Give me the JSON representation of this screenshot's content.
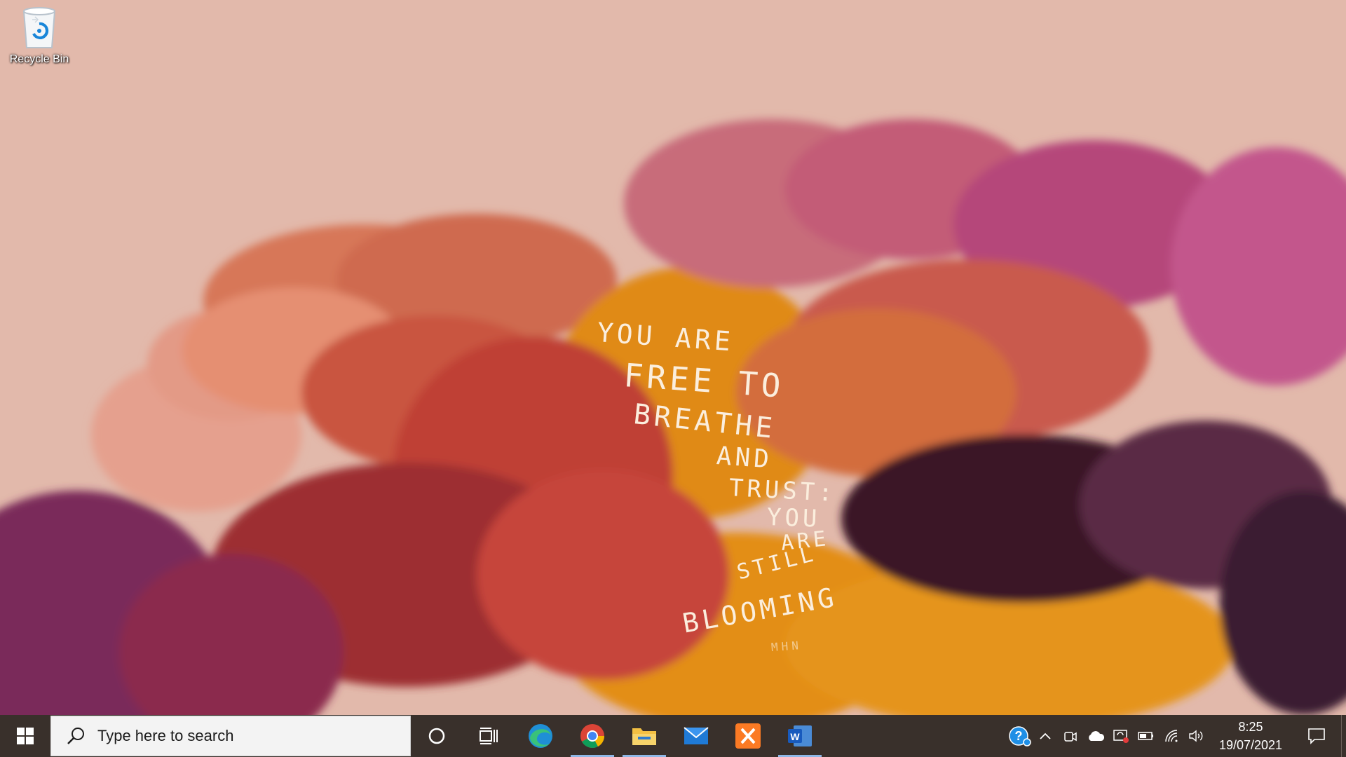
{
  "desktop": {
    "icons": [
      {
        "label": "Recycle Bin",
        "icon": "recycle-bin-icon"
      }
    ],
    "wallpaper": {
      "quote_lines": [
        "YOU ARE",
        "FREE TO",
        "BREATHE",
        "AND",
        "TRUST:",
        "YOU",
        "ARE",
        "STILL",
        "BLOOMING"
      ],
      "signature": "MHN",
      "colors": {
        "background": "#e2b9ab",
        "orange": "#e08a14",
        "red": "#b9473a",
        "plum": "#7a2a5a",
        "dark": "#3a1428",
        "pink": "#c76a8e"
      }
    }
  },
  "taskbar": {
    "start_icon": "windows-logo-icon",
    "search": {
      "placeholder": "Type here to search",
      "icon": "search-icon"
    },
    "cortana_icon": "cortana-circle-icon",
    "task_view_icon": "task-view-icon",
    "pinned_apps": [
      {
        "name": "Microsoft Edge",
        "icon": "edge-icon",
        "active": false
      },
      {
        "name": "Google Chrome",
        "icon": "chrome-icon",
        "active": true
      },
      {
        "name": "File Explorer",
        "icon": "file-explorer-icon",
        "active": true
      },
      {
        "name": "Mail",
        "icon": "mail-icon",
        "active": false
      },
      {
        "name": "XAMPP",
        "icon": "xampp-icon",
        "active": false
      },
      {
        "name": "Word",
        "icon": "word-icon",
        "active": true
      }
    ],
    "tray": {
      "icons": [
        "help-icon",
        "chevron-up-icon",
        "meet-now-icon",
        "onedrive-icon",
        "update-icon",
        "battery-icon",
        "wifi-icon",
        "volume-icon"
      ],
      "time": "8:25",
      "date": "19/07/2021",
      "notification_icon": "action-center-icon"
    },
    "colors": {
      "bar": "#39302b",
      "active_indicator": "#8fb7e6"
    }
  }
}
